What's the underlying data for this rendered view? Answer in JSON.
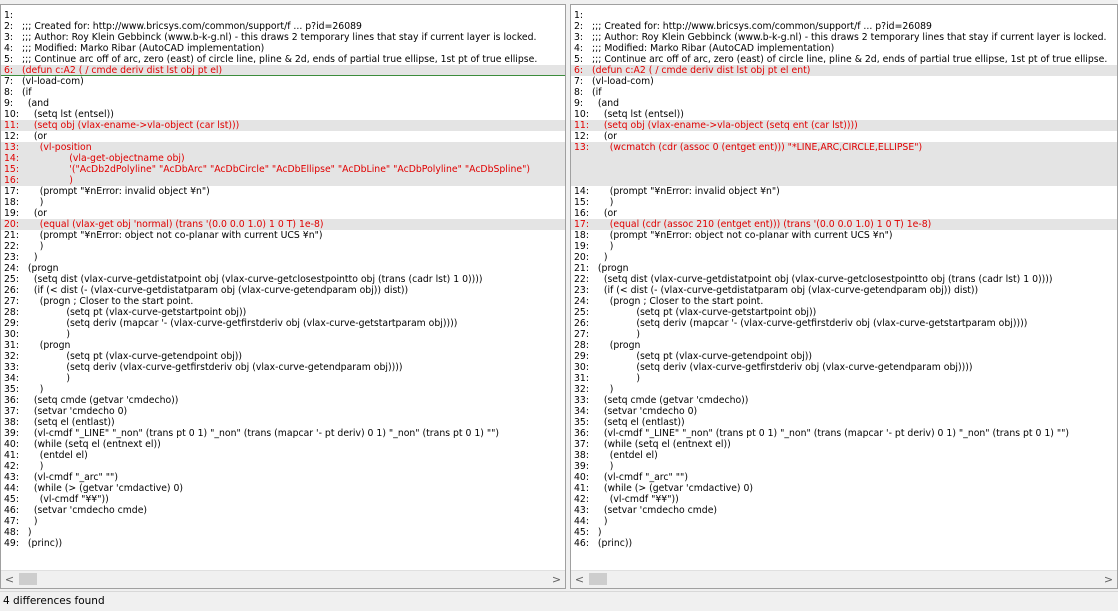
{
  "left_pane": {
    "lines": [
      {
        "num": "1:",
        "text": "",
        "diff": false
      },
      {
        "num": "2:",
        "text": ";;; Created for: http://www.bricsys.com/common/support/f ... p?id=26089",
        "diff": false
      },
      {
        "num": "3:",
        "text": ";;; Author: Roy Klein Gebbinck (www.b-k-g.nl) - this draws 2 temporary lines that stay if current layer is locked.",
        "diff": false
      },
      {
        "num": "4:",
        "text": ";;; Modified: Marko Ribar (AutoCAD implementation)",
        "diff": false
      },
      {
        "num": "5:",
        "text": ";;; Continue arc off of arc, zero (east) of circle line, pline & 2d, ends of partial true ellipse, 1st pt of true ellipse.",
        "diff": false
      },
      {
        "num": "6:",
        "text": "(defun c:A2 ( / cmde deriv dist lst obj pt el)",
        "diff": true,
        "cursor": true
      },
      {
        "num": "7:",
        "text": "(vl-load-com)",
        "diff": false
      },
      {
        "num": "8:",
        "text": "(if",
        "diff": false
      },
      {
        "num": "9:",
        "text": "  (and",
        "diff": false
      },
      {
        "num": "10:",
        "text": "    (setq lst (entsel))",
        "diff": false
      },
      {
        "num": "11:",
        "text": "    (setq obj (vlax-ename->vla-object (car lst)))",
        "diff": true
      },
      {
        "num": "12:",
        "text": "    (or",
        "diff": false
      },
      {
        "num": "13:",
        "text": "      (vl-position",
        "diff": true
      },
      {
        "num": "14:",
        "text": "                (vla-get-objectname obj)",
        "diff": true
      },
      {
        "num": "15:",
        "text": "                '(\"AcDb2dPolyline\" \"AcDbArc\" \"AcDbCircle\" \"AcDbEllipse\" \"AcDbLine\" \"AcDbPolyline\" \"AcDbSpline\")",
        "diff": true
      },
      {
        "num": "16:",
        "text": "                )",
        "diff": true
      },
      {
        "num": "17:",
        "text": "      (prompt \"¥nError: invalid object ¥n\")",
        "diff": false
      },
      {
        "num": "18:",
        "text": "      )",
        "diff": false
      },
      {
        "num": "19:",
        "text": "    (or",
        "diff": false
      },
      {
        "num": "20:",
        "text": "      (equal (vlax-get obj 'normal) (trans '(0.0 0.0 1.0) 1 0 T) 1e-8)",
        "diff": true
      },
      {
        "num": "21:",
        "text": "      (prompt \"¥nError: object not co-planar with current UCS ¥n\")",
        "diff": false
      },
      {
        "num": "22:",
        "text": "      )",
        "diff": false
      },
      {
        "num": "23:",
        "text": "    )",
        "diff": false
      },
      {
        "num": "24:",
        "text": "  (progn",
        "diff": false
      },
      {
        "num": "25:",
        "text": "    (setq dist (vlax-curve-getdistatpoint obj (vlax-curve-getclosestpointto obj (trans (cadr lst) 1 0))))",
        "diff": false
      },
      {
        "num": "26:",
        "text": "    (if (< dist (- (vlax-curve-getdistatparam obj (vlax-curve-getendparam obj)) dist))",
        "diff": false
      },
      {
        "num": "27:",
        "text": "      (progn ; Closer to the start point.",
        "diff": false
      },
      {
        "num": "28:",
        "text": "               (setq pt (vlax-curve-getstartpoint obj))",
        "diff": false
      },
      {
        "num": "29:",
        "text": "               (setq deriv (mapcar '- (vlax-curve-getfirstderiv obj (vlax-curve-getstartparam obj))))",
        "diff": false
      },
      {
        "num": "30:",
        "text": "               )",
        "diff": false
      },
      {
        "num": "31:",
        "text": "      (progn",
        "diff": false
      },
      {
        "num": "32:",
        "text": "               (setq pt (vlax-curve-getendpoint obj))",
        "diff": false
      },
      {
        "num": "33:",
        "text": "               (setq deriv (vlax-curve-getfirstderiv obj (vlax-curve-getendparam obj))))",
        "diff": false
      },
      {
        "num": "34:",
        "text": "               )",
        "diff": false
      },
      {
        "num": "35:",
        "text": "      )",
        "diff": false
      },
      {
        "num": "36:",
        "text": "    (setq cmde (getvar 'cmdecho))",
        "diff": false
      },
      {
        "num": "37:",
        "text": "    (setvar 'cmdecho 0)",
        "diff": false
      },
      {
        "num": "38:",
        "text": "    (setq el (entlast))",
        "diff": false
      },
      {
        "num": "39:",
        "text": "    (vl-cmdf \"_LINE\" \"_non\" (trans pt 0 1) \"_non\" (trans (mapcar '- pt deriv) 0 1) \"_non\" (trans pt 0 1) \"\")",
        "diff": false
      },
      {
        "num": "40:",
        "text": "    (while (setq el (entnext el))",
        "diff": false
      },
      {
        "num": "41:",
        "text": "      (entdel el)",
        "diff": false
      },
      {
        "num": "42:",
        "text": "      )",
        "diff": false
      },
      {
        "num": "43:",
        "text": "    (vl-cmdf \"_arc\" \"\")",
        "diff": false
      },
      {
        "num": "44:",
        "text": "    (while (> (getvar 'cmdactive) 0)",
        "diff": false
      },
      {
        "num": "45:",
        "text": "      (vl-cmdf \"¥¥\"))",
        "diff": false
      },
      {
        "num": "46:",
        "text": "    (setvar 'cmdecho cmde)",
        "diff": false
      },
      {
        "num": "47:",
        "text": "    )",
        "diff": false
      },
      {
        "num": "48:",
        "text": "  )",
        "diff": false
      },
      {
        "num": "49:",
        "text": "  (princ))",
        "diff": false
      }
    ]
  },
  "right_pane": {
    "lines": [
      {
        "num": "1:",
        "text": "",
        "diff": false
      },
      {
        "num": "2:",
        "text": ";;; Created for: http://www.bricsys.com/common/support/f ... p?id=26089",
        "diff": false
      },
      {
        "num": "3:",
        "text": ";;; Author: Roy Klein Gebbinck (www.b-k-g.nl) - this draws 2 temporary lines that stay if current layer is locked.",
        "diff": false
      },
      {
        "num": "4:",
        "text": ";;; Modified: Marko Ribar (AutoCAD implementation)",
        "diff": false
      },
      {
        "num": "5:",
        "text": ";;; Continue arc off of arc, zero (east) of circle line, pline & 2d, ends of partial true ellipse, 1st pt of true ellipse.",
        "diff": false
      },
      {
        "num": "6:",
        "text": "(defun c:A2 ( / cmde deriv dist lst obj pt el ent)",
        "diff": true
      },
      {
        "num": "7:",
        "text": "(vl-load-com)",
        "diff": false
      },
      {
        "num": "8:",
        "text": "(if",
        "diff": false
      },
      {
        "num": "9:",
        "text": "  (and",
        "diff": false
      },
      {
        "num": "10:",
        "text": "    (setq lst (entsel))",
        "diff": false
      },
      {
        "num": "11:",
        "text": "    (setq obj (vlax-ename->vla-object (setq ent (car lst))))",
        "diff": true
      },
      {
        "num": "12:",
        "text": "    (or",
        "diff": false
      },
      {
        "num": "13:",
        "text": "      (wcmatch (cdr (assoc 0 (entget ent))) \"*LINE,ARC,CIRCLE,ELLIPSE\")",
        "diff": true
      },
      {
        "num": "",
        "text": "",
        "blank": true
      },
      {
        "num": "",
        "text": "",
        "blank": true
      },
      {
        "num": "",
        "text": "",
        "blank": true
      },
      {
        "num": "14:",
        "text": "      (prompt \"¥nError: invalid object ¥n\")",
        "diff": false
      },
      {
        "num": "15:",
        "text": "      )",
        "diff": false
      },
      {
        "num": "16:",
        "text": "    (or",
        "diff": false
      },
      {
        "num": "17:",
        "text": "      (equal (cdr (assoc 210 (entget ent))) (trans '(0.0 0.0 1.0) 1 0 T) 1e-8)",
        "diff": true
      },
      {
        "num": "18:",
        "text": "      (prompt \"¥nError: object not co-planar with current UCS ¥n\")",
        "diff": false
      },
      {
        "num": "19:",
        "text": "      )",
        "diff": false
      },
      {
        "num": "20:",
        "text": "    )",
        "diff": false
      },
      {
        "num": "21:",
        "text": "  (progn",
        "diff": false
      },
      {
        "num": "22:",
        "text": "    (setq dist (vlax-curve-getdistatpoint obj (vlax-curve-getclosestpointto obj (trans (cadr lst) 1 0))))",
        "diff": false
      },
      {
        "num": "23:",
        "text": "    (if (< dist (- (vlax-curve-getdistatparam obj (vlax-curve-getendparam obj)) dist))",
        "diff": false
      },
      {
        "num": "24:",
        "text": "      (progn ; Closer to the start point.",
        "diff": false
      },
      {
        "num": "25:",
        "text": "               (setq pt (vlax-curve-getstartpoint obj))",
        "diff": false
      },
      {
        "num": "26:",
        "text": "               (setq deriv (mapcar '- (vlax-curve-getfirstderiv obj (vlax-curve-getstartparam obj))))",
        "diff": false
      },
      {
        "num": "27:",
        "text": "               )",
        "diff": false
      },
      {
        "num": "28:",
        "text": "      (progn",
        "diff": false
      },
      {
        "num": "29:",
        "text": "               (setq pt (vlax-curve-getendpoint obj))",
        "diff": false
      },
      {
        "num": "30:",
        "text": "               (setq deriv (vlax-curve-getfirstderiv obj (vlax-curve-getendparam obj))))",
        "diff": false
      },
      {
        "num": "31:",
        "text": "               )",
        "diff": false
      },
      {
        "num": "32:",
        "text": "      )",
        "diff": false
      },
      {
        "num": "33:",
        "text": "    (setq cmde (getvar 'cmdecho))",
        "diff": false
      },
      {
        "num": "34:",
        "text": "    (setvar 'cmdecho 0)",
        "diff": false
      },
      {
        "num": "35:",
        "text": "    (setq el (entlast))",
        "diff": false
      },
      {
        "num": "36:",
        "text": "    (vl-cmdf \"_LINE\" \"_non\" (trans pt 0 1) \"_non\" (trans (mapcar '- pt deriv) 0 1) \"_non\" (trans pt 0 1) \"\")",
        "diff": false
      },
      {
        "num": "37:",
        "text": "    (while (setq el (entnext el))",
        "diff": false
      },
      {
        "num": "38:",
        "text": "      (entdel el)",
        "diff": false
      },
      {
        "num": "39:",
        "text": "      )",
        "diff": false
      },
      {
        "num": "40:",
        "text": "    (vl-cmdf \"_arc\" \"\")",
        "diff": false
      },
      {
        "num": "41:",
        "text": "    (while (> (getvar 'cmdactive) 0)",
        "diff": false
      },
      {
        "num": "42:",
        "text": "      (vl-cmdf \"¥¥\"))",
        "diff": false
      },
      {
        "num": "43:",
        "text": "    (setvar 'cmdecho cmde)",
        "diff": false
      },
      {
        "num": "44:",
        "text": "    )",
        "diff": false
      },
      {
        "num": "45:",
        "text": "  )",
        "diff": false
      },
      {
        "num": "46:",
        "text": "  (princ))",
        "diff": false
      }
    ]
  },
  "scrollbar": {
    "left_arrow": "<",
    "right_arrow": ">"
  },
  "status": {
    "text": "4 differences found"
  },
  "colors": {
    "diff_text": "#e00000",
    "diff_background": "#e4e4e4"
  }
}
